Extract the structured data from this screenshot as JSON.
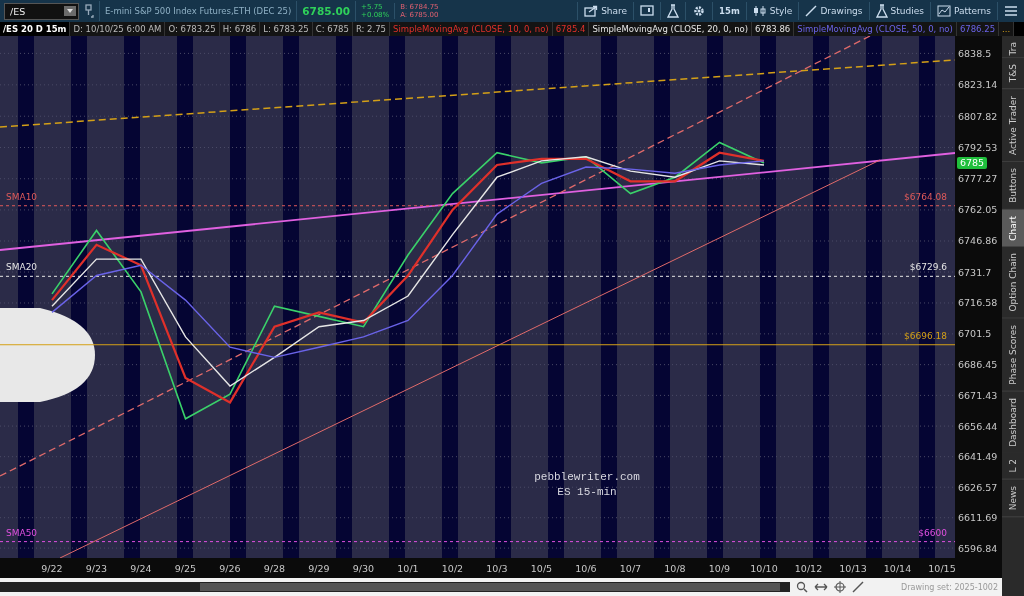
{
  "toolbar": {
    "symbol": "/ES",
    "description": "E-mini S&P 500 Index Futures,ETH (DEC 25)",
    "last": "6785.00",
    "change": "+5.75",
    "change_pct": "+0.08%",
    "bid": "B: 6784.75",
    "ask": "A: 6785.00",
    "buttons": [
      {
        "kind": "share",
        "label": "Share"
      },
      {
        "kind": "alert"
      },
      {
        "kind": "flask"
      },
      {
        "kind": "gear"
      },
      {
        "kind": "aggregation",
        "label": "15m"
      },
      {
        "kind": "style",
        "label": "Style"
      },
      {
        "kind": "drawings",
        "label": "Drawings"
      },
      {
        "kind": "studies",
        "label": "Studies"
      },
      {
        "kind": "patterns",
        "label": "Patterns"
      },
      {
        "kind": "menu"
      }
    ]
  },
  "info_bar": {
    "chart_label": "/ES 20 D 15m",
    "fields": [
      "D: 10/10/25 6:00 AM",
      "O: 6783.25",
      "H: 6786",
      "L: 6783.25",
      "C: 6785",
      "R: 2.75"
    ],
    "studies": [
      {
        "name": "SimpleMovingAvg (CLOSE, 10, 0, no)",
        "value": "6785.4"
      },
      {
        "name": "SimpleMovingAvg (CLOSE, 20, 0, no)",
        "value": "6783.86"
      },
      {
        "name": "SimpleMovingAvg (CLOSE, 50, 0, no)",
        "value": "6786.25"
      }
    ],
    "more": "..."
  },
  "chart": {
    "last_price_tag": "6785",
    "note": [
      "pebblewriter.com",
      "ES 15-min"
    ],
    "chart_data": {
      "type": "line",
      "grid": true,
      "categories": [
        "9/22",
        "9/23",
        "9/24",
        "9/25",
        "9/26",
        "9/28",
        "9/29",
        "9/30",
        "10/1",
        "10/2",
        "10/3",
        "10/5",
        "10/6",
        "10/7",
        "10/8",
        "10/9",
        "10/10",
        "10/12",
        "10/13",
        "10/14",
        "10/15"
      ],
      "series": [
        {
          "color": "#3ad16a",
          "values": [
            6721,
            6752,
            6722,
            6660,
            6672,
            6715,
            6710,
            6705,
            6740,
            6770,
            6790,
            6785,
            6788,
            6770,
            6778,
            6795,
            6785,
            null,
            null,
            null,
            null
          ]
        },
        {
          "color": "#e0302a",
          "values": [
            6718,
            6745,
            6735,
            6680,
            6668,
            6705,
            6712,
            6707,
            6730,
            6762,
            6784,
            6787,
            6787,
            6776,
            6776,
            6790,
            6786,
            null,
            null,
            null,
            null
          ]
        },
        {
          "color": "#e6e6e6",
          "values": [
            6715,
            6738,
            6738,
            6700,
            6676,
            6690,
            6705,
            6708,
            6720,
            6750,
            6778,
            6786,
            6788,
            6781,
            6778,
            6786,
            6784,
            null,
            null,
            null,
            null
          ]
        },
        {
          "color": "#6a63e8",
          "values": [
            6712,
            6730,
            6735,
            6718,
            6695,
            6690,
            6695,
            6700,
            6708,
            6730,
            6760,
            6775,
            6783,
            6782,
            6780,
            6784,
            6786,
            null,
            null,
            null,
            null
          ]
        }
      ],
      "ylim": [
        6592,
        6847
      ],
      "yticks": [
        6838.5,
        6823.14,
        6807.82,
        6792.53,
        6777.27,
        6762.05,
        6746.86,
        6731.7,
        6716.58,
        6701.5,
        6686.45,
        6671.43,
        6656.44,
        6641.49,
        6626.57,
        6611.69,
        6596.84
      ],
      "ref_lines": [
        {
          "axis": "y",
          "value": 6764.08,
          "label": "$6764.08",
          "color": "#e05a5a"
        },
        {
          "axis": "y",
          "value": 6729.6,
          "label": "$6729.6",
          "color": "#e6e6e6"
        },
        {
          "axis": "y",
          "value": 6600,
          "label": "$6600",
          "color": "#e050e0"
        },
        {
          "axis": "y",
          "value": 6696.18,
          "label": "$6696.18",
          "color": "#d4a017"
        }
      ]
    },
    "level_names": [
      "SMA10",
      "SMA20",
      "SMA50"
    ]
  },
  "side_tabs": [
    {
      "label": "Tra",
      "selected": false
    },
    {
      "label": "T&S",
      "selected": false
    },
    {
      "label": "Active Trader",
      "selected": false
    },
    {
      "label": "Buttons",
      "selected": false
    },
    {
      "label": "Chart",
      "selected": true
    },
    {
      "label": "Option Chain",
      "selected": false
    },
    {
      "label": "Phase Scores",
      "selected": false
    },
    {
      "label": "Dashboard",
      "selected": false
    },
    {
      "label": "L 2",
      "selected": false
    },
    {
      "label": "News",
      "selected": false
    }
  ],
  "footer": {
    "drawing_set": "Drawing set: 2025-1002"
  }
}
